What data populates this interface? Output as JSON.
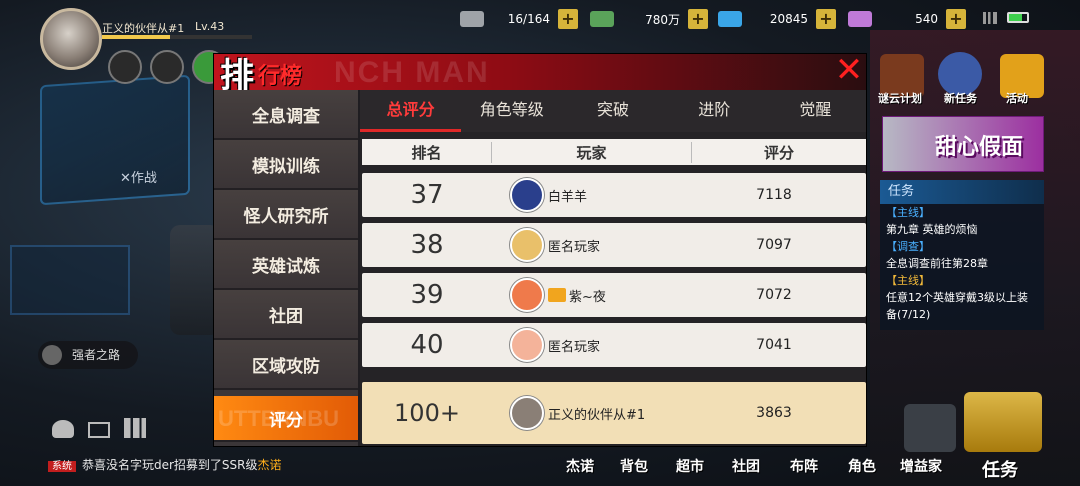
{
  "player": {
    "name": "正义的伙伴从#1",
    "level": "Lv.43",
    "exp_fraction": 0.45
  },
  "resources": [
    {
      "value": "16/164",
      "icon": "stamina-icon",
      "color": "#9fa3a8"
    },
    {
      "value": "780万",
      "icon": "cash-icon",
      "color": "#5aa35a"
    },
    {
      "value": "20845",
      "icon": "diamond-icon",
      "color": "#3aa6e8"
    },
    {
      "value": "540",
      "icon": "gem-icon",
      "color": "#c07ad8"
    }
  ],
  "panel": {
    "title_first": "排",
    "title_rest": "行榜",
    "ghost_text": "NCH MAN"
  },
  "side_menu": [
    {
      "label": "全息调查"
    },
    {
      "label": "模拟训练"
    },
    {
      "label": "怪人研究所"
    },
    {
      "label": "英雄试炼"
    },
    {
      "label": "社团"
    },
    {
      "label": "区域攻防"
    },
    {
      "label": "评分"
    }
  ],
  "tabs": [
    "总评分",
    "角色等级",
    "突破",
    "进阶",
    "觉醒"
  ],
  "table": {
    "headers": [
      "排名",
      "玩家",
      "评分"
    ],
    "rows": [
      {
        "rank": "37",
        "name": "白羊羊",
        "score": "7118",
        "avatar_color": "#2a3f8c"
      },
      {
        "rank": "38",
        "name": "匿名玩家",
        "score": "7097",
        "avatar_color": "#e9c06a"
      },
      {
        "rank": "39",
        "name": "紫~夜",
        "score": "7072",
        "avatar_color": "#ef7a4b",
        "badge": "crown"
      },
      {
        "rank": "40",
        "name": "匿名玩家",
        "score": "7041",
        "avatar_color": "#f4b39a"
      }
    ],
    "me": {
      "rank": "100+",
      "name": "正义的伙伴从#1",
      "score": "3863"
    }
  },
  "right_side": {
    "plan_label": "谜云计划",
    "task_label": "新任务",
    "activity_label": "活动",
    "event_text": "甜心假面",
    "quest_title": "任务",
    "quests": [
      {
        "tag": "【主线】",
        "text": "第九章 英雄的烦恼"
      },
      {
        "tag": "【调查】",
        "text": "全息调查前往第28章"
      },
      {
        "tag": "【主线】",
        "text": "任意12个英雄穿戴3级以上装备(7/12)"
      }
    ]
  },
  "left_labels": {
    "battle": "✕作战",
    "strong_road": "强者之路"
  },
  "ticker": {
    "tag": "系统",
    "text": "恭喜没名字玩der招募到了SSR级",
    "highlight": "杰诺"
  },
  "bottom_bar": [
    "杰诺",
    "背包",
    "超市",
    "社团",
    "布阵",
    "角色",
    "增益家",
    "任务"
  ],
  "mini_icons": [
    "附近队伍",
    "更多",
    "微信"
  ]
}
